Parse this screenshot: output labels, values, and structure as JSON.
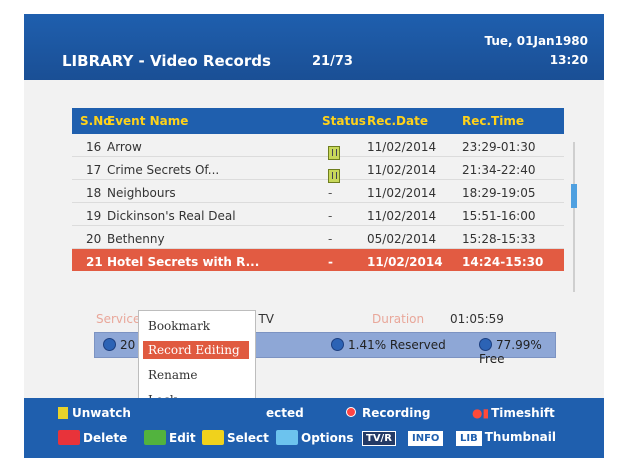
{
  "header": {
    "title": "LIBRARY - Video Records",
    "counter": "21/73",
    "date": "Tue, 01Jan1980",
    "time": "13:20"
  },
  "table": {
    "columns": [
      "S.No",
      "Event Name",
      "Status",
      "Rec.Date",
      "Rec.Time"
    ],
    "rows": [
      {
        "no": "16",
        "name": "Arrow",
        "status": "icon",
        "date": "11/02/2014",
        "time": "23:29-01:30"
      },
      {
        "no": "17",
        "name": "Crime Secrets Of...",
        "status": "icon",
        "date": "11/02/2014",
        "time": "21:34-22:40"
      },
      {
        "no": "18",
        "name": "Neighbours",
        "status": "-",
        "date": "11/02/2014",
        "time": "18:29-19:05"
      },
      {
        "no": "19",
        "name": "Dickinson's Real Deal",
        "status": "-",
        "date": "11/02/2014",
        "time": "15:51-16:00"
      },
      {
        "no": "20",
        "name": "Bethenny",
        "status": "-",
        "date": "05/02/2014",
        "time": "15:28-15:33"
      },
      {
        "no": "21",
        "name": "Hotel Secrets with R...",
        "status": "-",
        "date": "11/02/2014",
        "time": "14:24-15:30"
      }
    ],
    "selected_index": 5,
    "status_icon_name": "locked-icon"
  },
  "info": {
    "service_label_faded": "Service Name",
    "channel": "Choice TV",
    "duration_label_faded": "Duration",
    "duration": "01:05:59"
  },
  "storage": {
    "used_partial": "20",
    "reserved": "1.41% Reserved",
    "free": "77.99% Free"
  },
  "popup_menu": {
    "items": [
      "Bookmark",
      "Record Editing",
      "Rename",
      "Lock"
    ],
    "active_index": 1
  },
  "footer": {
    "unwatch": "Unwatch",
    "selected_partial": "ected",
    "recording": "Recording",
    "timeshift": "Timeshift",
    "delete": "Delete",
    "edit": "Edit",
    "select": "Select",
    "options": "Options",
    "tvr_chip": "TV/R",
    "info_chip": "INFO",
    "lib_chip": "LIB",
    "thumbnail": "Thumbnail"
  },
  "colors": {
    "header_blue": "#1f5fae",
    "selected_row": "#e25b42",
    "column_header_text": "#ffd21a",
    "key_red": "#e8333a",
    "key_green": "#52b33e",
    "key_yellow": "#f0d21c",
    "key_blue": "#6cc3ee"
  }
}
